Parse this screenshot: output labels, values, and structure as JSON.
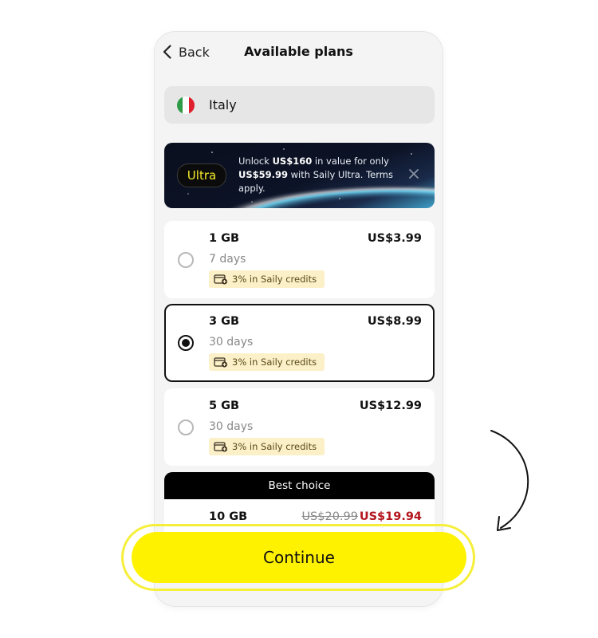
{
  "header": {
    "back_label": "Back",
    "title": "Available plans"
  },
  "country": {
    "name": "Italy",
    "flag_colors": [
      "#2e9b46",
      "#ffffff",
      "#e0202c"
    ]
  },
  "promo": {
    "badge": "Ultra",
    "text_1": "Unlock ",
    "highlight_1": "US$160",
    "text_2": " in value for only ",
    "highlight_2": "US$59.99",
    "text_3": " with Saily Ultra. Terms apply."
  },
  "plans": [
    {
      "size": "1 GB",
      "days": "7 days",
      "price": "US$3.99",
      "credits": "3% in Saily credits",
      "selected": false
    },
    {
      "size": "3 GB",
      "days": "30 days",
      "price": "US$8.99",
      "credits": "3% in Saily credits",
      "selected": true
    },
    {
      "size": "5 GB",
      "days": "30 days",
      "price": "US$12.99",
      "credits": "3% in Saily credits",
      "selected": false
    }
  ],
  "best_choice": {
    "label": "Best choice",
    "size": "10 GB",
    "old_price": "US$20.99",
    "new_price": "US$19.94"
  },
  "continue_label": "Continue",
  "colors": {
    "accent_yellow": "#fff200",
    "sale_red": "#b3151c",
    "credits_bg": "#fcf0c8"
  }
}
